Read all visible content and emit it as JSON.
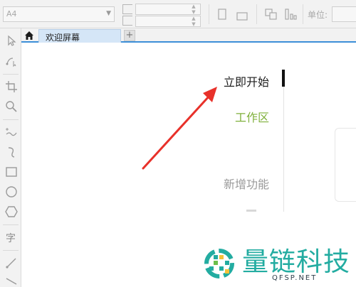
{
  "property_bar": {
    "paper_size": "A4",
    "unit_label": "单位:"
  },
  "document_tabs": {
    "home_icon": "home-icon",
    "tabs": [
      {
        "label": "欢迎屏幕"
      }
    ],
    "add_icon": "plus-icon"
  },
  "welcome_menu": {
    "items": [
      {
        "label": "立即开始",
        "selected": true
      },
      {
        "label": "工作区"
      },
      {
        "label": "新增功能"
      }
    ]
  },
  "watermark": {
    "title": "量链科技",
    "subtitle": "QFSP.NET"
  },
  "colors": {
    "accent_blue": "#3c8fd8",
    "workspace_green": "#7fb03b",
    "annotation_red": "#e8312a",
    "watermark_teal": "#23aca1"
  }
}
